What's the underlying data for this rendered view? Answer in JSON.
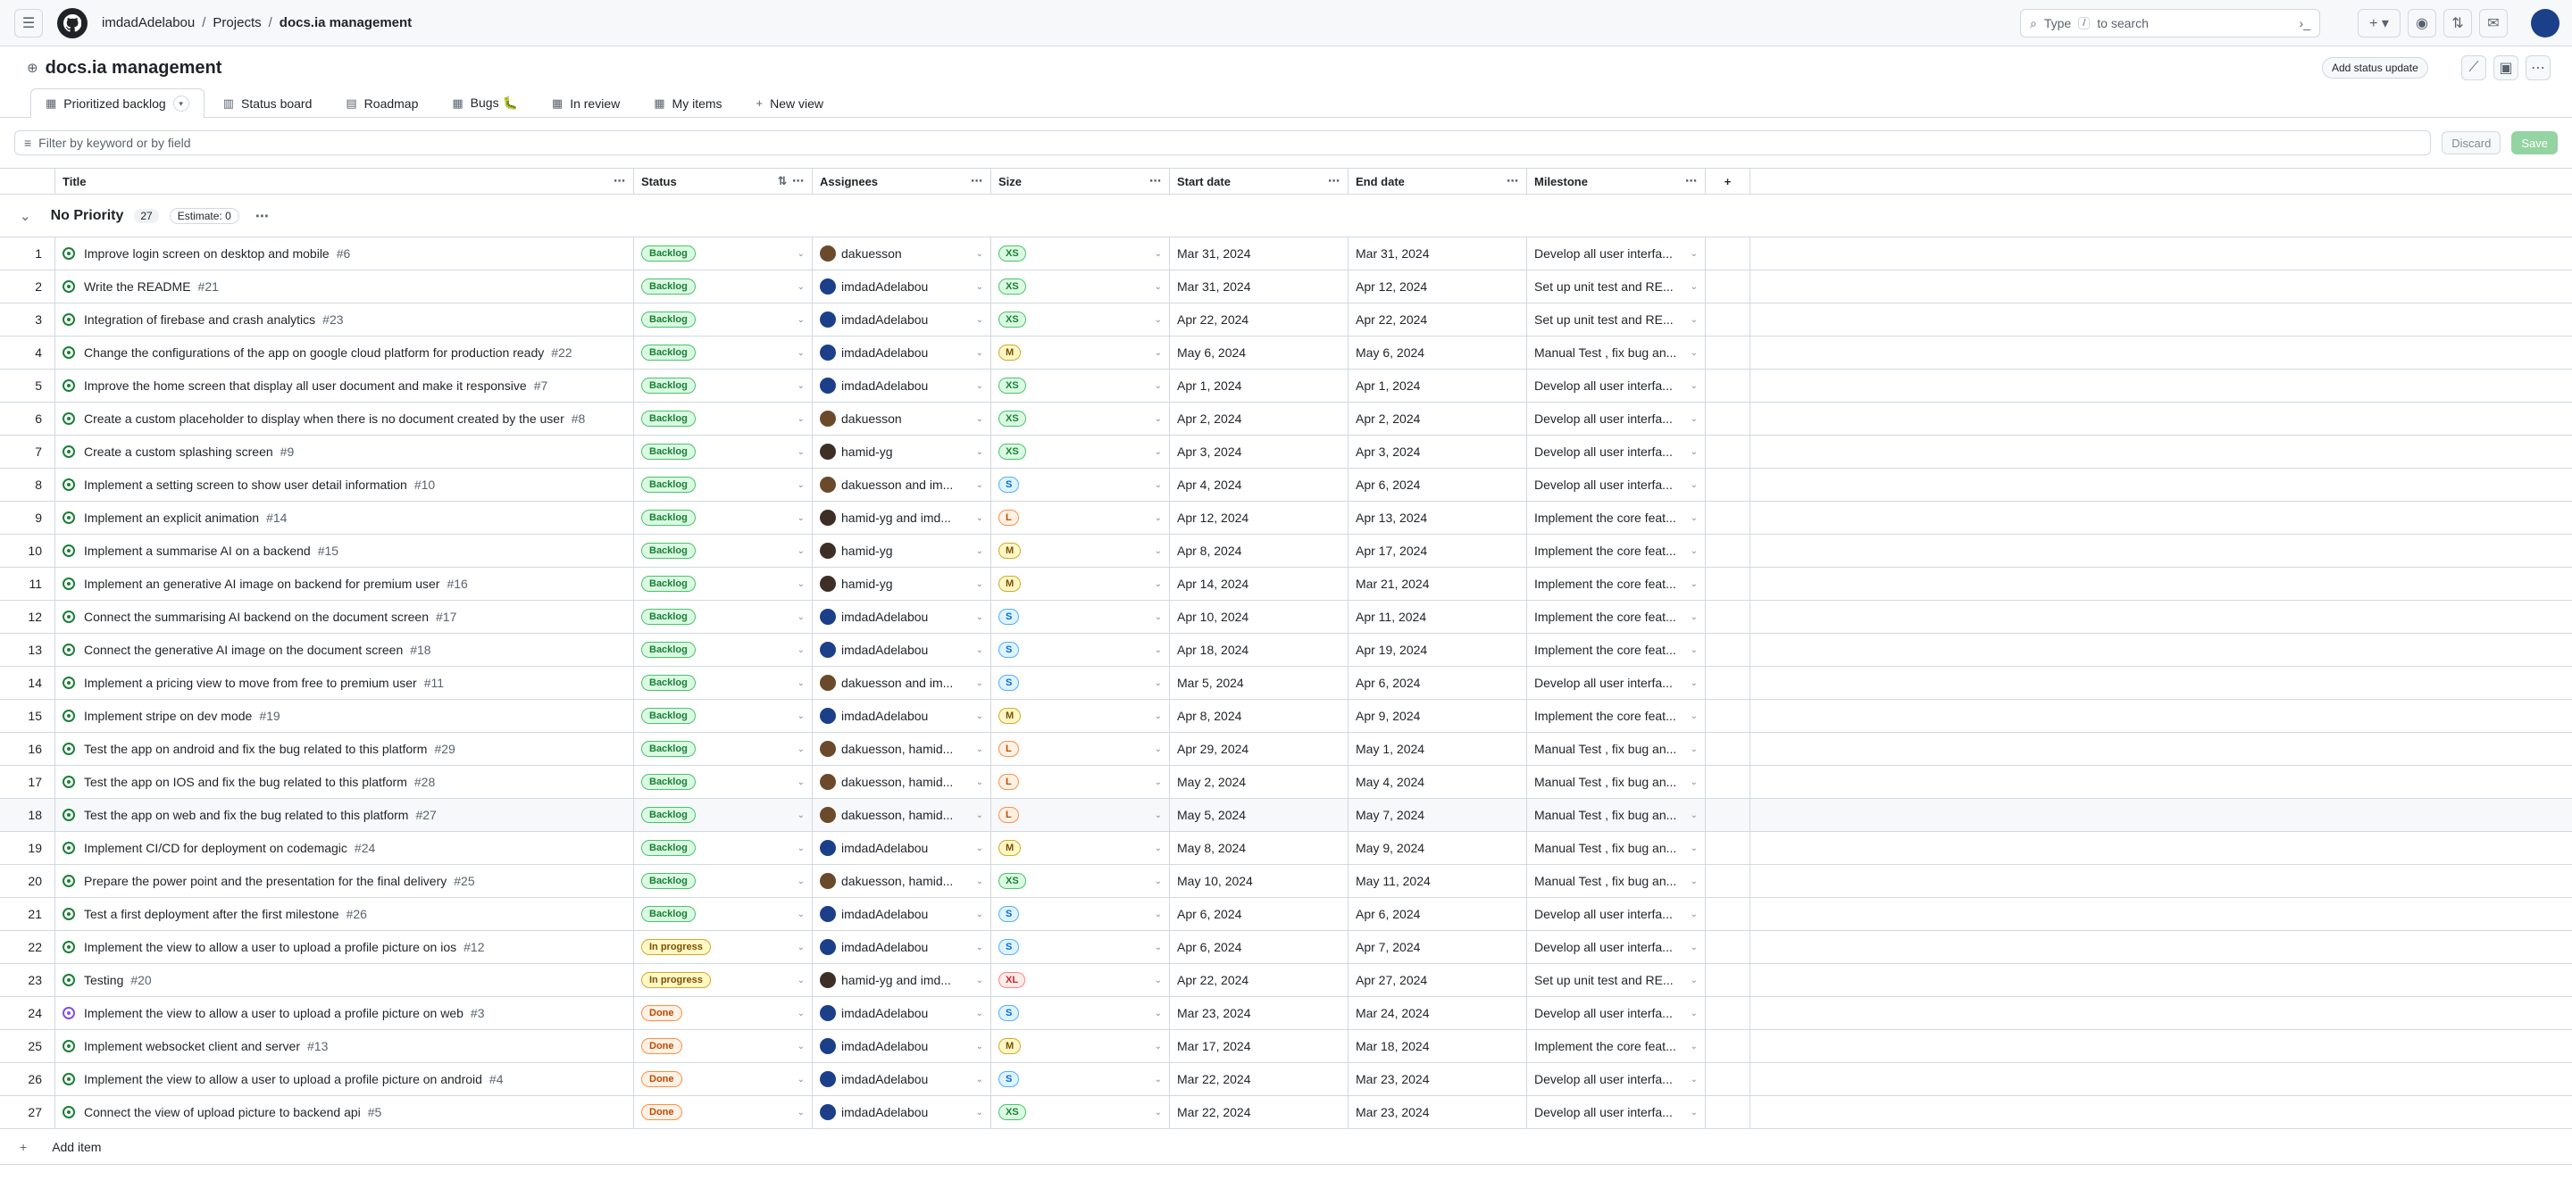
{
  "header": {
    "owner": "imdadAdelabou",
    "projects": "Projects",
    "project": "docs.ia management",
    "search_pre": "Type",
    "search_key": "/",
    "search_post": "to search"
  },
  "page": {
    "title": "docs.ia management",
    "add_status_update": "Add status update"
  },
  "tabs": [
    {
      "label": "Prioritized backlog"
    },
    {
      "label": "Status board"
    },
    {
      "label": "Roadmap"
    },
    {
      "label": "Bugs 🐛"
    },
    {
      "label": "In review"
    },
    {
      "label": "My items"
    },
    {
      "label": "New view"
    }
  ],
  "filter": {
    "placeholder": "Filter by keyword or by field",
    "discard": "Discard",
    "save": "Save"
  },
  "columns": [
    "Title",
    "Status",
    "Assignees",
    "Size",
    "Start date",
    "End date",
    "Milestone"
  ],
  "group": {
    "name": "No Priority",
    "count": "27",
    "estimate": "Estimate: 0"
  },
  "rows": [
    {
      "n": "1",
      "title": "Improve login screen on desktop and mobile",
      "ref": "#6",
      "status": "Backlog",
      "assignee": "dakuesson",
      "av": "dk",
      "size": "XS",
      "start": "Mar 31, 2024",
      "end": "Mar 31, 2024",
      "milestone": "Develop all user interfa..."
    },
    {
      "n": "2",
      "title": "Write the README",
      "ref": "#21",
      "status": "Backlog",
      "assignee": "imdadAdelabou",
      "av": "im",
      "size": "XS",
      "start": "Mar 31, 2024",
      "end": "Apr 12, 2024",
      "milestone": "Set up unit test and RE..."
    },
    {
      "n": "3",
      "title": "Integration of firebase and crash analytics",
      "ref": "#23",
      "status": "Backlog",
      "assignee": "imdadAdelabou",
      "av": "im",
      "size": "XS",
      "start": "Apr 22, 2024",
      "end": "Apr 22, 2024",
      "milestone": "Set up unit test and RE..."
    },
    {
      "n": "4",
      "title": "Change the configurations of the app on google cloud platform for production ready",
      "ref": "#22",
      "status": "Backlog",
      "assignee": "imdadAdelabou",
      "av": "im",
      "size": "M",
      "start": "May 6, 2024",
      "end": "May 6, 2024",
      "milestone": "Manual Test , fix bug an..."
    },
    {
      "n": "5",
      "title": "Improve the home screen that display all user document and make it responsive",
      "ref": "#7",
      "status": "Backlog",
      "assignee": "imdadAdelabou",
      "av": "im",
      "size": "XS",
      "start": "Apr 1, 2024",
      "end": "Apr 1, 2024",
      "milestone": "Develop all user interfa..."
    },
    {
      "n": "6",
      "title": "Create a custom placeholder to display when there is no document created by the user",
      "ref": "#8",
      "status": "Backlog",
      "assignee": "dakuesson",
      "av": "dk",
      "size": "XS",
      "start": "Apr 2, 2024",
      "end": "Apr 2, 2024",
      "milestone": "Develop all user interfa..."
    },
    {
      "n": "7",
      "title": "Create a custom splashing screen",
      "ref": "#9",
      "status": "Backlog",
      "assignee": "hamid-yg",
      "av": "hm",
      "size": "XS",
      "start": "Apr 3, 2024",
      "end": "Apr 3, 2024",
      "milestone": "Develop all user interfa..."
    },
    {
      "n": "8",
      "title": "Implement a setting screen to show user detail information",
      "ref": "#10",
      "status": "Backlog",
      "assignee": "dakuesson and im...",
      "av": "dk",
      "size": "S",
      "start": "Apr 4, 2024",
      "end": "Apr 6, 2024",
      "milestone": "Develop all user interfa..."
    },
    {
      "n": "9",
      "title": "Implement an explicit animation",
      "ref": "#14",
      "status": "Backlog",
      "assignee": "hamid-yg and imd...",
      "av": "hm",
      "size": "L",
      "start": "Apr 12, 2024",
      "end": "Apr 13, 2024",
      "milestone": "Implement the core feat..."
    },
    {
      "n": "10",
      "title": "Implement a summarise AI on a backend",
      "ref": "#15",
      "status": "Backlog",
      "assignee": "hamid-yg",
      "av": "hm",
      "size": "M",
      "start": "Apr 8, 2024",
      "end": "Apr 17, 2024",
      "milestone": "Implement the core feat..."
    },
    {
      "n": "11",
      "title": "Implement an generative AI image on backend for premium user",
      "ref": "#16",
      "status": "Backlog",
      "assignee": "hamid-yg",
      "av": "hm",
      "size": "M",
      "start": "Apr 14, 2024",
      "end": "Mar 21, 2024",
      "milestone": "Implement the core feat..."
    },
    {
      "n": "12",
      "title": "Connect the summarising AI backend on the document screen",
      "ref": "#17",
      "status": "Backlog",
      "assignee": "imdadAdelabou",
      "av": "im",
      "size": "S",
      "start": "Apr 10, 2024",
      "end": "Apr 11, 2024",
      "milestone": "Implement the core feat..."
    },
    {
      "n": "13",
      "title": "Connect the generative AI image on the document screen",
      "ref": "#18",
      "status": "Backlog",
      "assignee": "imdadAdelabou",
      "av": "im",
      "size": "S",
      "start": "Apr 18, 2024",
      "end": "Apr 19, 2024",
      "milestone": "Implement the core feat..."
    },
    {
      "n": "14",
      "title": "Implement a pricing view to move from free to premium user",
      "ref": "#11",
      "status": "Backlog",
      "assignee": "dakuesson and im...",
      "av": "dk",
      "size": "S",
      "start": "Mar 5, 2024",
      "end": "Apr 6, 2024",
      "milestone": "Develop all user interfa..."
    },
    {
      "n": "15",
      "title": "Implement stripe on dev mode",
      "ref": "#19",
      "status": "Backlog",
      "assignee": "imdadAdelabou",
      "av": "im",
      "size": "M",
      "start": "Apr 8, 2024",
      "end": "Apr 9, 2024",
      "milestone": "Implement the core feat..."
    },
    {
      "n": "16",
      "title": "Test the app on android and fix the bug related to this platform",
      "ref": "#29",
      "status": "Backlog",
      "assignee": "dakuesson, hamid...",
      "av": "dk",
      "size": "L",
      "start": "Apr 29, 2024",
      "end": "May 1, 2024",
      "milestone": "Manual Test , fix bug an..."
    },
    {
      "n": "17",
      "title": "Test the app on IOS and fix the bug related to this platform",
      "ref": "#28",
      "status": "Backlog",
      "assignee": "dakuesson, hamid...",
      "av": "dk",
      "size": "L",
      "start": "May 2, 2024",
      "end": "May 4, 2024",
      "milestone": "Manual Test , fix bug an..."
    },
    {
      "n": "18",
      "title": "Test the app on web and fix the bug related to this platform",
      "ref": "#27",
      "status": "Backlog",
      "assignee": "dakuesson, hamid...",
      "av": "dk",
      "size": "L",
      "start": "May 5, 2024",
      "end": "May 7, 2024",
      "milestone": "Manual Test , fix bug an..."
    },
    {
      "n": "19",
      "title": "Implement CI/CD for deployment on codemagic",
      "ref": "#24",
      "status": "Backlog",
      "assignee": "imdadAdelabou",
      "av": "im",
      "size": "M",
      "start": "May 8, 2024",
      "end": "May 9, 2024",
      "milestone": "Manual Test , fix bug an..."
    },
    {
      "n": "20",
      "title": "Prepare the power point and the presentation for the final delivery",
      "ref": "#25",
      "status": "Backlog",
      "assignee": "dakuesson, hamid...",
      "av": "dk",
      "size": "XS",
      "start": "May 10, 2024",
      "end": "May 11, 2024",
      "milestone": "Manual Test , fix bug an..."
    },
    {
      "n": "21",
      "title": "Test a first deployment after the first milestone",
      "ref": "#26",
      "status": "Backlog",
      "assignee": "imdadAdelabou",
      "av": "im",
      "size": "S",
      "start": "Apr 6, 2024",
      "end": "Apr 6, 2024",
      "milestone": "Develop all user interfa..."
    },
    {
      "n": "22",
      "title": "Implement the view to allow a user to upload a profile picture on ios",
      "ref": "#12",
      "status": "In progress",
      "assignee": "imdadAdelabou",
      "av": "im",
      "size": "S",
      "start": "Apr 6, 2024",
      "end": "Apr 7, 2024",
      "milestone": "Develop all user interfa..."
    },
    {
      "n": "23",
      "title": "Testing",
      "ref": "#20",
      "status": "In progress",
      "assignee": "hamid-yg and imd...",
      "av": "hm",
      "size": "XL",
      "start": "Apr 22, 2024",
      "end": "Apr 27, 2024",
      "milestone": "Set up unit test and RE..."
    },
    {
      "n": "24",
      "title": "Implement the view to allow a user to upload a profile picture on web",
      "ref": "#3",
      "status": "Done",
      "assignee": "imdadAdelabou",
      "av": "im",
      "size": "S",
      "start": "Mar 23, 2024",
      "end": "Mar 24, 2024",
      "milestone": "Develop all user interfa..."
    },
    {
      "n": "25",
      "title": "Implement websocket client and server",
      "ref": "#13",
      "status": "Done",
      "assignee": "imdadAdelabou",
      "av": "im",
      "size": "M",
      "start": "Mar 17, 2024",
      "end": "Mar 18, 2024",
      "milestone": "Implement the core feat..."
    },
    {
      "n": "26",
      "title": "Implement the view to allow a user to upload a profile picture on android",
      "ref": "#4",
      "status": "Done",
      "assignee": "imdadAdelabou",
      "av": "im",
      "size": "S",
      "start": "Mar 22, 2024",
      "end": "Mar 23, 2024",
      "milestone": "Develop all user interfa..."
    },
    {
      "n": "27",
      "title": "Connect the view of upload picture to backend api",
      "ref": "#5",
      "status": "Done",
      "assignee": "imdadAdelabou",
      "av": "im",
      "size": "XS",
      "start": "Mar 22, 2024",
      "end": "Mar 23, 2024",
      "milestone": "Develop all user interfa..."
    }
  ],
  "add_item": "Add item"
}
